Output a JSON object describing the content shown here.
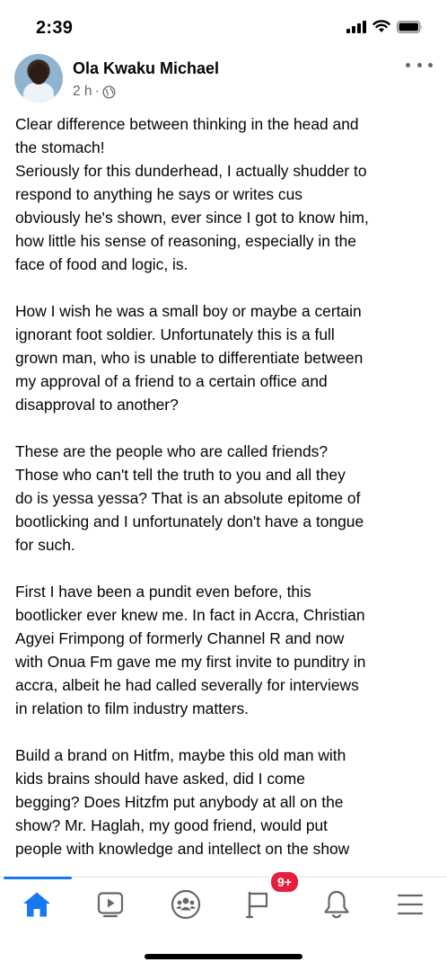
{
  "status_bar": {
    "time": "2:39"
  },
  "post": {
    "author": "Ola Kwaku Michael",
    "time_ago": "2 h",
    "separator": "·",
    "privacy_icon": "globe-icon",
    "paragraphs": [
      [
        "Clear difference between thinking in the head and",
        "the stomach!",
        "Seriously for this dunderhead, I actually shudder to",
        "respond to anything he says or writes cus",
        "obviously he's shown, ever since I got to know him,",
        "how little his sense of reasoning, especially in the",
        "face of food and logic, is."
      ],
      [
        "How I wish he was a small boy or maybe a certain",
        "ignorant foot soldier. Unfortunately this is a full",
        "grown man, who is unable to differentiate between",
        "my approval of a friend to a certain office and",
        "disapproval to another?"
      ],
      [
        "These are the people who are called friends?",
        "Those who can't tell the truth to you and all they",
        "do is yessa yessa? That is an absolute epitome of",
        "bootlicking and I unfortunately don't have a tongue",
        "for such."
      ],
      [
        "First I have been a pundit even before, this",
        "bootlicker ever knew me. In fact in Accra, Christian",
        "Agyei Frimpong of formerly Channel R and now",
        "with Onua Fm gave me my first invite to punditry in",
        "accra, albeit he had called severally for interviews",
        "in relation to film industry matters."
      ],
      [
        "Build a brand on Hitfm, maybe this old man with",
        "kids brains should have asked, did I come",
        "begging? Does Hitzfm put anybody at all on the",
        "show? Mr. Haglah, my good friend, would put",
        "people with knowledge and intellect on the show"
      ]
    ]
  },
  "tab_bar": {
    "active_color": "#1877f2",
    "tabs": [
      {
        "name": "home",
        "icon": "home-icon"
      },
      {
        "name": "video",
        "icon": "video-icon"
      },
      {
        "name": "groups",
        "icon": "groups-icon"
      },
      {
        "name": "pages",
        "icon": "flag-icon"
      },
      {
        "name": "notifications",
        "icon": "bell-icon"
      },
      {
        "name": "menu",
        "icon": "menu-icon"
      }
    ],
    "pages_badge": "9+"
  },
  "colors": {
    "badge": "#e41e3f",
    "meta_text": "#65676b"
  }
}
